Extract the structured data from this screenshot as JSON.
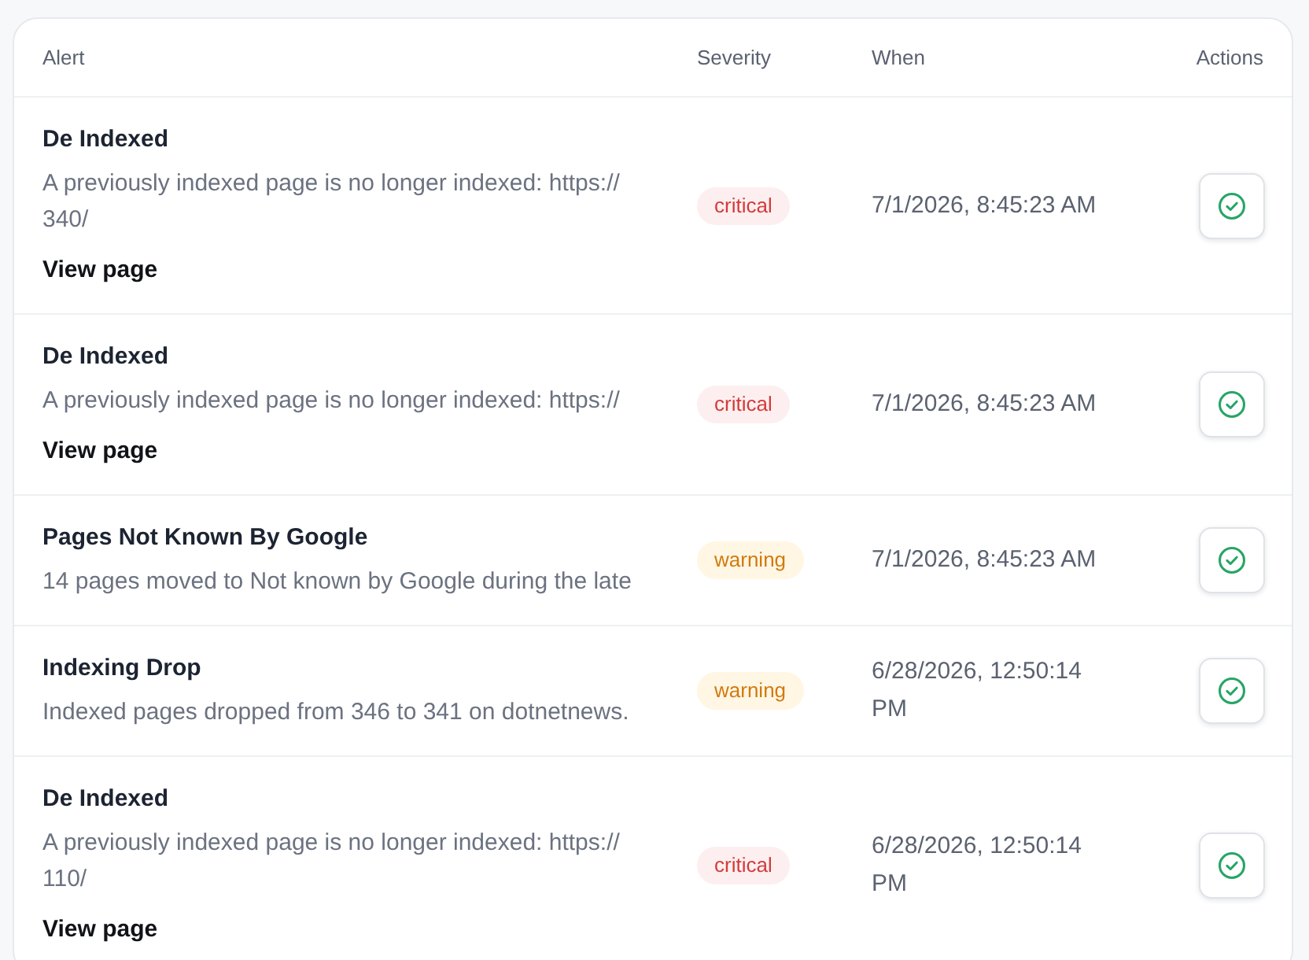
{
  "table": {
    "columns": [
      "Alert",
      "Severity",
      "When",
      "Actions"
    ],
    "rows": [
      {
        "title": "De Indexed",
        "description_lines": [
          "A previously indexed page is no longer indexed: https://",
          "340/"
        ],
        "link": "View page",
        "badge": {
          "label": "critical",
          "kind": "critical"
        },
        "when": "7/1/2026, 8:45:23 AM"
      },
      {
        "title": "De Indexed",
        "description_lines": [
          "A previously indexed page is no longer indexed: https://"
        ],
        "link": "View page",
        "badge": {
          "label": "critical",
          "kind": "critical"
        },
        "when": "7/1/2026, 8:45:23 AM"
      },
      {
        "title": "Pages Not Known By Google",
        "description_lines": [
          "14 pages moved to Not known by Google during the late"
        ],
        "badge": {
          "label": "warning",
          "kind": "warning"
        },
        "when": "7/1/2026, 8:45:23 AM"
      },
      {
        "title": "Indexing Drop",
        "description_lines": [
          "Indexed pages dropped from 346 to 341 on dotnetnews."
        ],
        "badge": {
          "label": "warning",
          "kind": "warning"
        },
        "when": "6/28/2026, 12:50:14 PM"
      },
      {
        "title": "De Indexed",
        "description_lines": [
          "A previously indexed page is no longer indexed: https://",
          "110/"
        ],
        "link": "View page",
        "badge": {
          "label": "critical",
          "kind": "critical"
        },
        "when": "6/28/2026, 12:50:14 PM"
      }
    ]
  }
}
